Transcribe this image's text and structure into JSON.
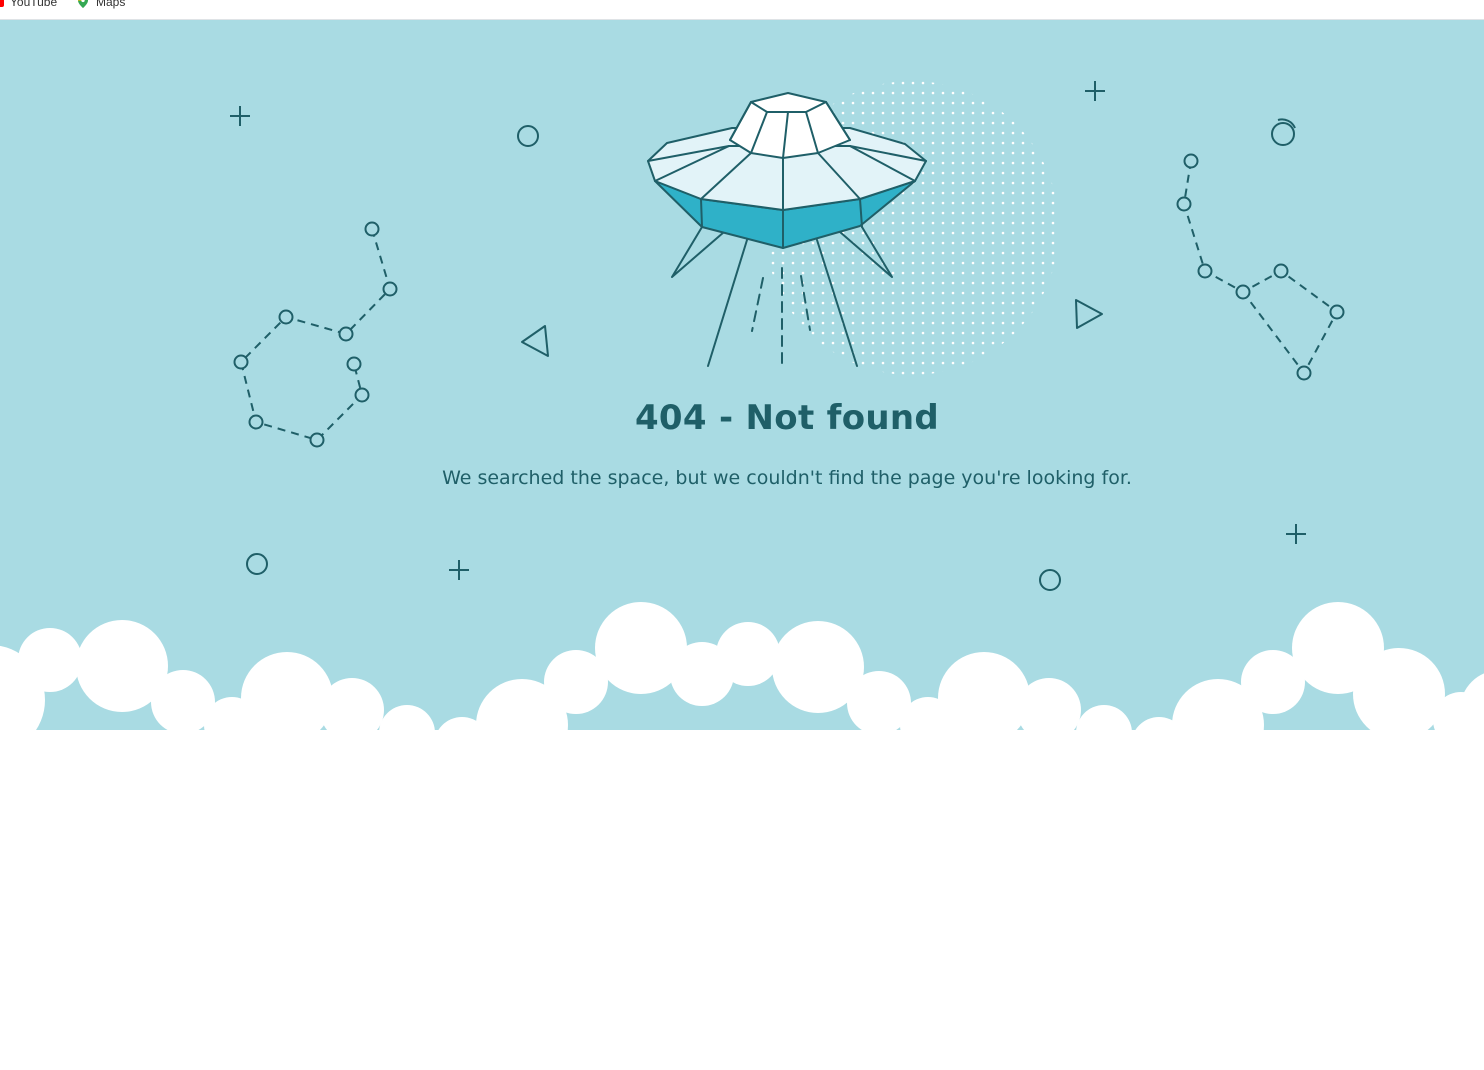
{
  "bookmarks": [
    {
      "label": "YouTube",
      "icon": "youtube-icon"
    },
    {
      "label": "Maps",
      "icon": "maps-icon"
    }
  ],
  "error": {
    "title": "404 - Not found",
    "message": "We searched the space, but we couldn't find the page you're looking for."
  },
  "colors": {
    "sky": "#a9dbe3",
    "ink": "#1f5f68",
    "saucer_accent": "#2fb1c8",
    "saucer_light": "#e2f3f8",
    "cloud": "#ffffff"
  },
  "illustration": {
    "main": "ufo-icon",
    "decorations": [
      "constellation-icon",
      "plus-icon",
      "circle-icon",
      "triangle-icon",
      "dot-pattern",
      "clouds"
    ]
  }
}
